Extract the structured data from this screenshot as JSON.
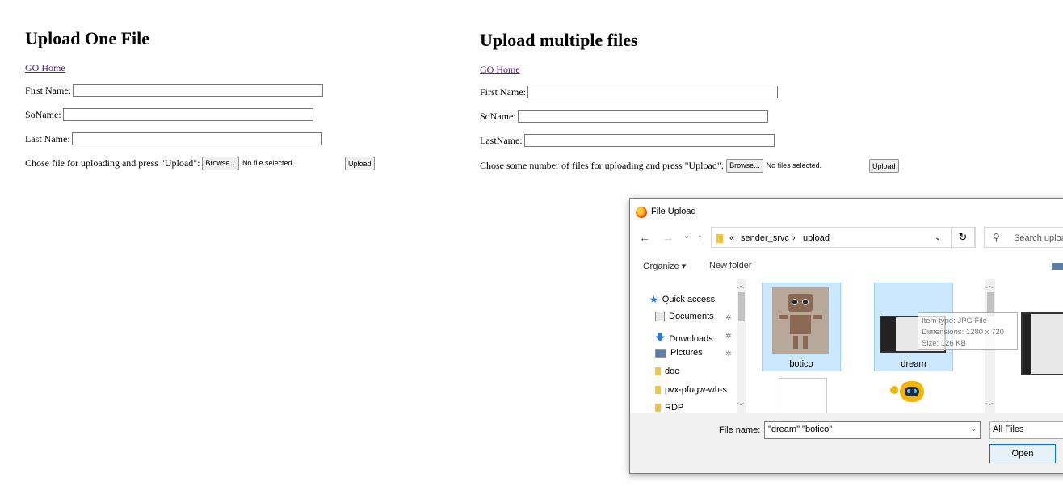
{
  "single": {
    "title": "Upload One File",
    "home_link": "GO Home",
    "first_name_label": "First Name:",
    "so_name_label": "SoName:",
    "last_name_label": "Last Name:",
    "file_prompt": "Chose file for uploading and press \"Upload\":",
    "browse_label": "Browse...",
    "file_status": "No file selected.",
    "upload_label": "Upload"
  },
  "multi": {
    "title": "Upload multiple files",
    "home_link": "GO Home",
    "first_name_label": "First Name:",
    "so_name_label": "SoName:",
    "last_name_label": "LastName:",
    "file_prompt": "Chose some number of files for uploading and press \"Upload\":",
    "browse_label": "Browse...",
    "file_status": "No files selected.",
    "upload_label": "Upload"
  },
  "dialog": {
    "title": "File Upload",
    "nav": {
      "back": "←",
      "forward": "→",
      "recent": "⌄",
      "up": "↑"
    },
    "address": {
      "prefix": "«",
      "crumbs": [
        "sender_srvc",
        "upload"
      ],
      "separator": "›",
      "dropdown": "⌄"
    },
    "refresh": "↻",
    "search_placeholder": "Search uploa",
    "toolbar": {
      "organize": "Organize ▾",
      "new_folder": "New folder"
    },
    "sidebar": {
      "items": [
        {
          "label": "Quick access",
          "icon": "star-icon",
          "pinned": false
        },
        {
          "label": "Documents",
          "icon": "documents-icon",
          "pinned": true
        },
        {
          "label": "Downloads",
          "icon": "downloads-icon",
          "pinned": true
        },
        {
          "label": "Pictures",
          "icon": "pictures-icon",
          "pinned": true
        },
        {
          "label": "doc",
          "icon": "folder-icon",
          "pinned": false
        },
        {
          "label": "pvx-pfugw-wh-s",
          "icon": "folder-icon",
          "pinned": false
        },
        {
          "label": "RDP",
          "icon": "folder-icon",
          "pinned": false
        }
      ],
      "pin_glyph": "✲"
    },
    "files": [
      {
        "name": "botico",
        "selected": true
      },
      {
        "name": "dream",
        "selected": true
      }
    ],
    "tooltip": {
      "type": "Item type: JPG File",
      "dimensions": "Dimensions: 1280 x 720",
      "size": "Size: 126 KB"
    },
    "footer": {
      "file_name_label": "File name:",
      "file_name_value": "\"dream\" \"botico\"",
      "filter_value": "All Files",
      "open_label": "Open"
    },
    "colors": {
      "selection": "#cce8ff",
      "selection_border": "#99d1ff",
      "accent": "#0078d7",
      "folder": "#f4c542"
    }
  }
}
